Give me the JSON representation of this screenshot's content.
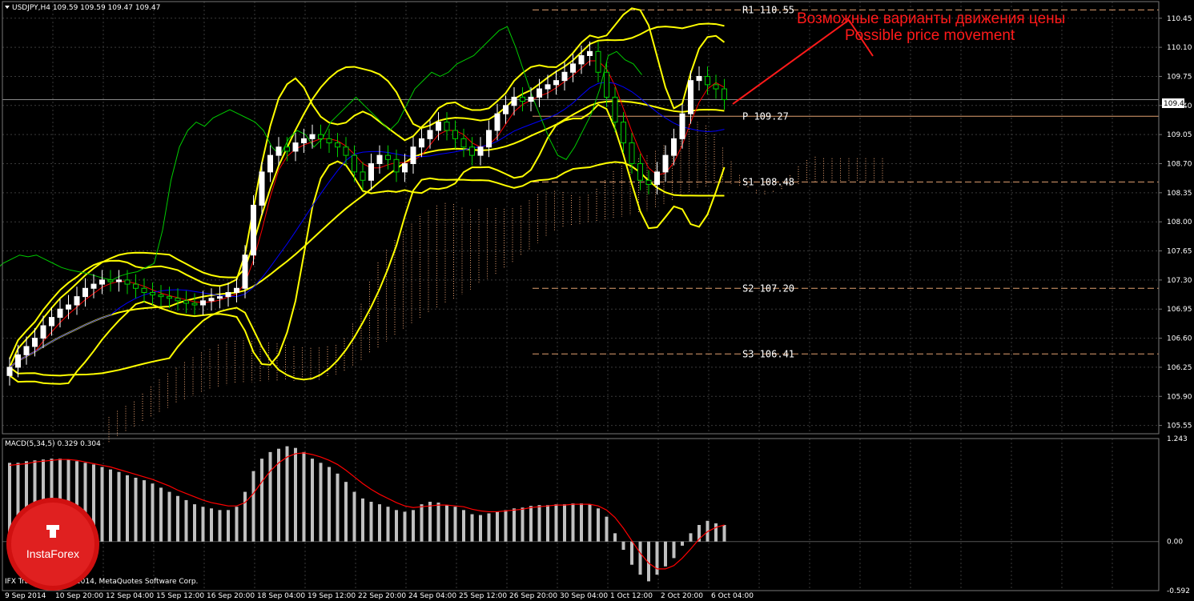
{
  "header": {
    "symbol_info": "USDJPY,H4  109.59 109.59 109.47 109.47"
  },
  "macd_header": "MACD(5,34,5) 0.329 0.304",
  "copyright": "IFX Trader, © 2001-2014, MetaQuotes Software Corp.",
  "logo_text": "InstaForex",
  "annotation": {
    "ru": "Возможные варианты движения цены",
    "en": "Possible price movement"
  },
  "current_price_label": "109.47",
  "colors": {
    "background": "#000000",
    "grid": "#3a3a3a",
    "candle_up": "#ffffff",
    "candle_down": "#00d000",
    "bollinger": "#ffff00",
    "tenkan": "#ff0000",
    "kijun": "#0000ff",
    "chikou": "#00cc00",
    "cloud": "#e8a070",
    "pivot_lines": "#e0a070",
    "annotation": "#ff1a1a",
    "macd_hist": "#c0c0c0",
    "macd_signal": "#ff0000"
  },
  "chart_data": {
    "type": "candlestick",
    "symbol": "USDJPY",
    "timeframe": "H4",
    "ylim": [
      105.45,
      110.65
    ],
    "y_ticks": [
      "110.45",
      "110.10",
      "109.75",
      "109.40",
      "109.05",
      "108.70",
      "108.35",
      "108.00",
      "107.65",
      "107.30",
      "106.95",
      "106.60",
      "106.25",
      "105.90",
      "105.55"
    ],
    "x_ticks": [
      "9 Sep 2014",
      "10 Sep 20:00",
      "12 Sep 04:00",
      "15 Sep 12:00",
      "16 Sep 20:00",
      "18 Sep 04:00",
      "19 Sep 12:00",
      "22 Sep 20:00",
      "24 Sep 04:00",
      "25 Sep 12:00",
      "26 Sep 20:00",
      "30 Sep 04:00",
      "1 Oct 12:00",
      "2 Oct 20:00",
      "6 Oct 04:00"
    ],
    "pivot_levels": [
      {
        "name": "R1",
        "label": "R1 110.55",
        "value": 110.55
      },
      {
        "name": "P",
        "label": "P 109.27",
        "value": 109.27
      },
      {
        "name": "S1",
        "label": "S1 108.48",
        "value": 108.48
      },
      {
        "name": "S2",
        "label": "S2 107.20",
        "value": 107.2
      },
      {
        "name": "S3",
        "label": "S3 106.41",
        "value": 106.41
      }
    ],
    "current_price": 109.47,
    "closes": [
      106.25,
      106.4,
      106.5,
      106.6,
      106.75,
      106.85,
      106.95,
      107.0,
      107.1,
      107.2,
      107.25,
      107.3,
      107.28,
      107.3,
      107.25,
      107.2,
      107.15,
      107.12,
      107.1,
      107.08,
      107.05,
      107.02,
      107.0,
      107.05,
      107.08,
      107.1,
      107.15,
      107.2,
      107.6,
      108.2,
      108.6,
      108.8,
      108.9,
      108.85,
      108.95,
      109.0,
      109.05,
      109.0,
      108.95,
      108.9,
      108.8,
      108.6,
      108.5,
      108.7,
      108.8,
      108.75,
      108.6,
      108.7,
      108.9,
      109.0,
      109.1,
      109.2,
      109.1,
      109.0,
      108.9,
      108.8,
      108.9,
      109.1,
      109.3,
      109.4,
      109.5,
      109.45,
      109.5,
      109.6,
      109.65,
      109.7,
      109.8,
      109.9,
      110.0,
      110.05,
      109.8,
      109.5,
      109.2,
      108.95,
      108.7,
      108.5,
      108.45,
      108.6,
      108.8,
      109.0,
      109.3,
      109.7,
      109.75,
      109.65,
      109.6,
      109.47
    ],
    "macd": {
      "ylim": [
        -0.592,
        1.243
      ],
      "y_ticks": [
        "1.243",
        "0.00",
        "-0.592"
      ],
      "histogram": [
        0.95,
        0.95,
        0.97,
        0.98,
        0.99,
        1.0,
        1.0,
        0.99,
        0.97,
        0.95,
        0.93,
        0.9,
        0.87,
        0.84,
        0.8,
        0.77,
        0.74,
        0.7,
        0.65,
        0.6,
        0.55,
        0.5,
        0.45,
        0.42,
        0.4,
        0.38,
        0.38,
        0.42,
        0.6,
        0.85,
        1.0,
        1.08,
        1.12,
        1.15,
        1.13,
        1.08,
        1.0,
        0.95,
        0.9,
        0.82,
        0.72,
        0.6,
        0.52,
        0.48,
        0.45,
        0.42,
        0.38,
        0.36,
        0.38,
        0.45,
        0.48,
        0.47,
        0.44,
        0.42,
        0.38,
        0.33,
        0.32,
        0.34,
        0.36,
        0.38,
        0.4,
        0.41,
        0.43,
        0.44,
        0.44,
        0.45,
        0.45,
        0.46,
        0.46,
        0.45,
        0.4,
        0.3,
        0.1,
        -0.1,
        -0.28,
        -0.4,
        -0.48,
        -0.4,
        -0.3,
        -0.2,
        -0.05,
        0.1,
        0.2,
        0.25,
        0.22,
        0.2
      ],
      "signal": [
        0.92,
        0.93,
        0.94,
        0.96,
        0.97,
        0.98,
        0.99,
        0.99,
        0.98,
        0.96,
        0.94,
        0.92,
        0.9,
        0.87,
        0.84,
        0.81,
        0.78,
        0.75,
        0.71,
        0.67,
        0.62,
        0.58,
        0.54,
        0.5,
        0.47,
        0.45,
        0.43,
        0.43,
        0.47,
        0.58,
        0.72,
        0.85,
        0.95,
        1.02,
        1.06,
        1.07,
        1.05,
        1.02,
        0.98,
        0.93,
        0.86,
        0.78,
        0.7,
        0.63,
        0.57,
        0.52,
        0.47,
        0.43,
        0.41,
        0.42,
        0.43,
        0.44,
        0.44,
        0.43,
        0.42,
        0.39,
        0.37,
        0.36,
        0.36,
        0.37,
        0.38,
        0.39,
        0.41,
        0.42,
        0.43,
        0.44,
        0.44,
        0.45,
        0.45,
        0.45,
        0.43,
        0.38,
        0.29,
        0.16,
        0.01,
        -0.14,
        -0.26,
        -0.33,
        -0.33,
        -0.29,
        -0.2,
        -0.09,
        0.03,
        0.12,
        0.17,
        0.2
      ]
    }
  }
}
